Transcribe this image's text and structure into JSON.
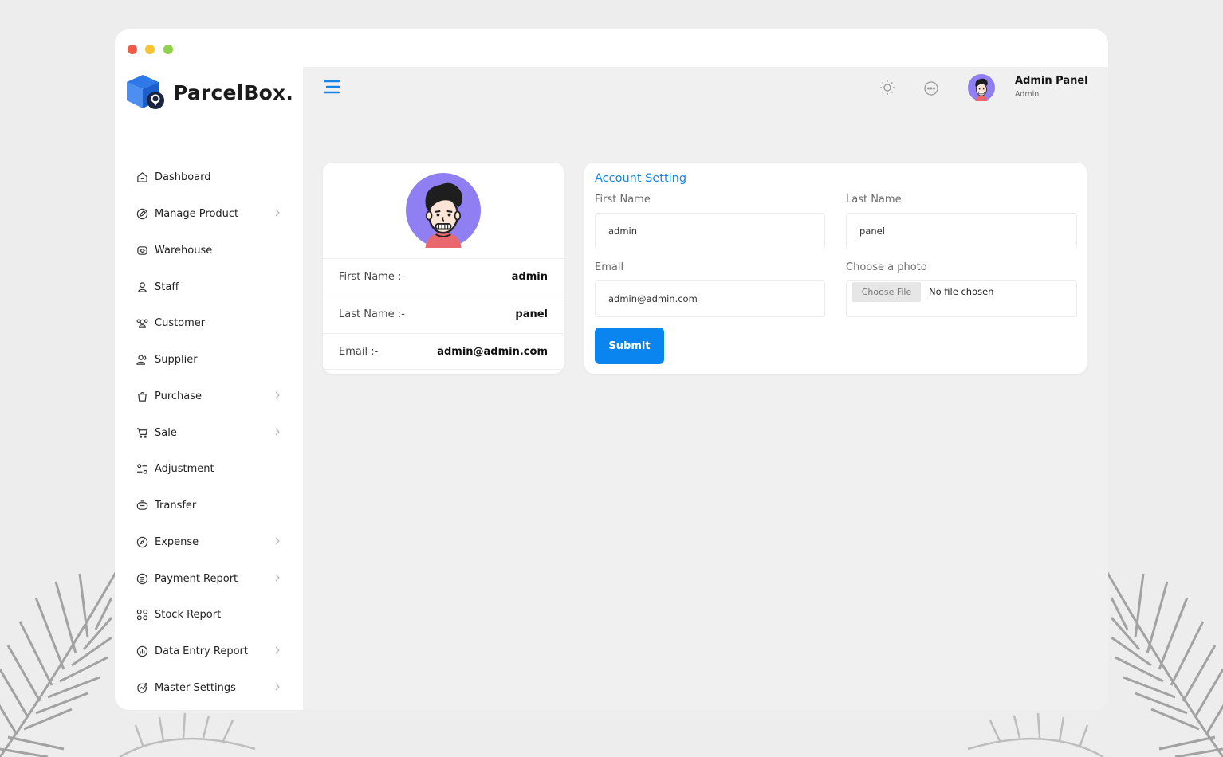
{
  "brand": {
    "name": "ParcelBox."
  },
  "window": {
    "dots": [
      "#f35a4a",
      "#f7c531",
      "#8fd14f"
    ]
  },
  "nav": {
    "items": [
      {
        "label": "Dashboard",
        "icon": "home-icon",
        "has_chevron": false
      },
      {
        "label": "Manage Product",
        "icon": "edit-icon",
        "has_chevron": true
      },
      {
        "label": "Warehouse",
        "icon": "warehouse-icon",
        "has_chevron": false
      },
      {
        "label": "Staff",
        "icon": "user-icon",
        "has_chevron": false
      },
      {
        "label": "Customer",
        "icon": "users-icon",
        "has_chevron": false
      },
      {
        "label": "Supplier",
        "icon": "user-plus-icon",
        "has_chevron": false
      },
      {
        "label": "Purchase",
        "icon": "bag-icon",
        "has_chevron": true
      },
      {
        "label": "Sale",
        "icon": "cart-icon",
        "has_chevron": true
      },
      {
        "label": "Adjustment",
        "icon": "sliders-icon",
        "has_chevron": false
      },
      {
        "label": "Transfer",
        "icon": "transfer-icon",
        "has_chevron": false
      },
      {
        "label": "Expense",
        "icon": "compass-icon",
        "has_chevron": true
      },
      {
        "label": "Payment Report",
        "icon": "receipt-icon",
        "has_chevron": true
      },
      {
        "label": "Stock Report",
        "icon": "grid-icon",
        "has_chevron": false
      },
      {
        "label": "Data Entry Report",
        "icon": "chart-icon",
        "has_chevron": true
      },
      {
        "label": "Master Settings",
        "icon": "settings-icon",
        "has_chevron": true
      }
    ]
  },
  "topbar": {
    "menu_icon": "hamburger-icon",
    "theme_icon": "sun-icon",
    "chat_icon": "chat-icon",
    "profile_name": "Admin Panel",
    "profile_role": "Admin"
  },
  "profile_card": {
    "rows": [
      {
        "label": "First Name :-",
        "value": "admin"
      },
      {
        "label": "Last Name :-",
        "value": "panel"
      },
      {
        "label": "Email :-",
        "value": "admin@admin.com"
      }
    ]
  },
  "account": {
    "title": "Account Setting",
    "first_name_label": "First Name",
    "first_name_value": "admin",
    "last_name_label": "Last Name",
    "last_name_value": "panel",
    "email_label": "Email",
    "email_value": "admin@admin.com",
    "photo_label": "Choose a photo",
    "choose_file_label": "Choose File",
    "no_file_text": "No file chosen",
    "submit_label": "Submit"
  },
  "colors": {
    "accent": "#0a84ef",
    "title": "#1a84e5",
    "avatar_bg": "#8f7ff2"
  }
}
